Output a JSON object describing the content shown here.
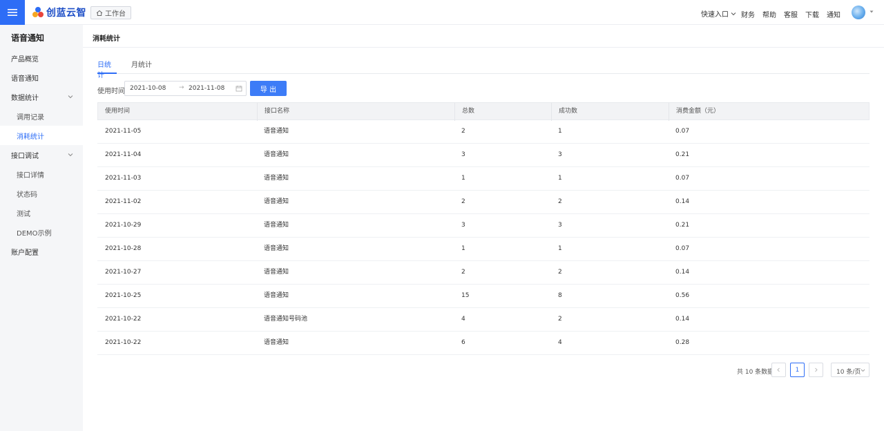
{
  "brand": {
    "name": "创蓝云智",
    "accent": "#2d6df6"
  },
  "topbar": {
    "workbench_label": "工作台",
    "quick_entry_label": "快速入口",
    "links": {
      "finance": "财务",
      "help": "帮助",
      "service": "客服",
      "download": "下载",
      "notice": "通知"
    }
  },
  "sidebar": {
    "title": "语音通知",
    "items": [
      {
        "label": "产品概览"
      },
      {
        "label": "语音通知"
      },
      {
        "label": "数据统计"
      },
      {
        "label": "调用记录"
      },
      {
        "label": "消耗统计"
      },
      {
        "label": "接口调试"
      },
      {
        "label": "接口详情"
      },
      {
        "label": "状态码"
      },
      {
        "label": "测试"
      },
      {
        "label": "DEMO示例"
      },
      {
        "label": "账户配置"
      }
    ]
  },
  "page": {
    "title": "消耗统计",
    "tabs": [
      {
        "label": "日统计"
      },
      {
        "label": "月统计"
      }
    ],
    "filter": {
      "label": "使用时间:",
      "start_date": "2021-10-08",
      "separator": "→",
      "end_date": "2021-11-08"
    },
    "export_label": "导 出"
  },
  "table": {
    "headers": [
      "使用时间",
      "接口名称",
      "总数",
      "成功数",
      "消费金额（元）"
    ],
    "rows": [
      [
        "2021-11-05",
        "语音通知",
        "2",
        "1",
        "0.07"
      ],
      [
        "2021-11-04",
        "语音通知",
        "3",
        "3",
        "0.21"
      ],
      [
        "2021-11-03",
        "语音通知",
        "1",
        "1",
        "0.07"
      ],
      [
        "2021-11-02",
        "语音通知",
        "2",
        "2",
        "0.14"
      ],
      [
        "2021-10-29",
        "语音通知",
        "3",
        "3",
        "0.21"
      ],
      [
        "2021-10-28",
        "语音通知",
        "1",
        "1",
        "0.07"
      ],
      [
        "2021-10-27",
        "语音通知",
        "2",
        "2",
        "0.14"
      ],
      [
        "2021-10-25",
        "语音通知",
        "15",
        "8",
        "0.56"
      ],
      [
        "2021-10-22",
        "语音通知号码池",
        "4",
        "2",
        "0.14"
      ],
      [
        "2021-10-22",
        "语音通知",
        "6",
        "4",
        "0.28"
      ]
    ]
  },
  "pagination": {
    "total_text": "共 10 条数据",
    "current_page": "1",
    "page_size": "10 条/页"
  }
}
